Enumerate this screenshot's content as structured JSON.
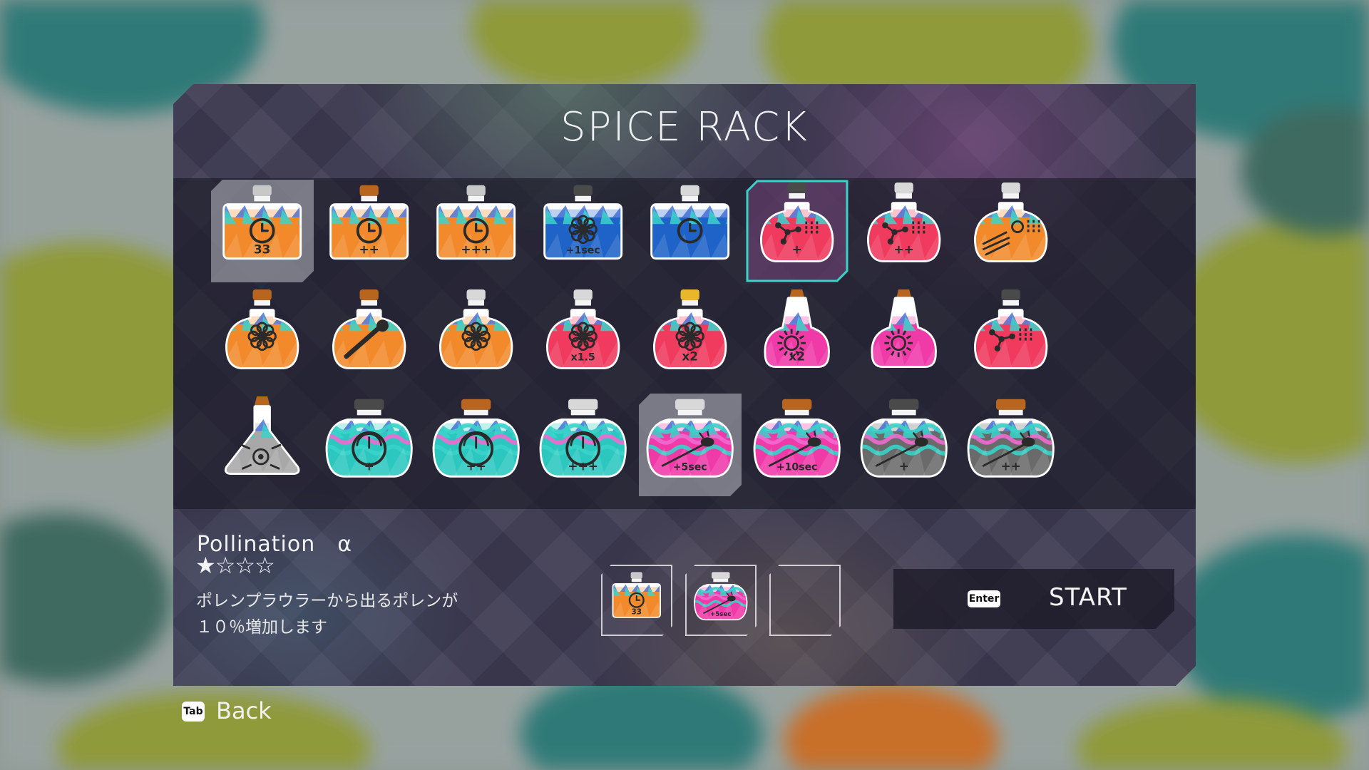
{
  "screen": {
    "title": "SPICE RACK"
  },
  "spices": [
    {
      "row": 0,
      "col": 0,
      "liquid": "#f28a2c",
      "cap": "#c8c8c8",
      "shape": "square",
      "icon": "clock-icon",
      "label": "33",
      "state": "hover"
    },
    {
      "row": 0,
      "col": 1,
      "liquid": "#f28a2c",
      "cap": "#b8661f",
      "shape": "square",
      "icon": "clock-icon",
      "label": "++",
      "state": "normal"
    },
    {
      "row": 0,
      "col": 2,
      "liquid": "#f28a2c",
      "cap": "#c8c8c8",
      "shape": "square",
      "icon": "clock-icon",
      "label": "+++",
      "state": "normal"
    },
    {
      "row": 0,
      "col": 3,
      "liquid": "#1f63c8",
      "cap": "#4a4a4a",
      "shape": "square",
      "icon": "flower-icon",
      "label": "+1sec",
      "state": "normal"
    },
    {
      "row": 0,
      "col": 4,
      "liquid": "#1f63c8",
      "cap": "#d8d8d8",
      "shape": "square",
      "icon": "clock-icon",
      "label": "",
      "state": "normal"
    },
    {
      "row": 0,
      "col": 5,
      "liquid": "#f03a5e",
      "cap": "#4a4a4a",
      "shape": "round",
      "icon": "molecule-icon",
      "label": "+",
      "state": "selected"
    },
    {
      "row": 0,
      "col": 6,
      "liquid": "#f03a5e",
      "cap": "#d8d8d8",
      "shape": "round",
      "icon": "molecule-icon",
      "label": "++",
      "state": "normal"
    },
    {
      "row": 0,
      "col": 7,
      "liquid": "#f28a2c",
      "cap": "#d8d8d8",
      "shape": "round",
      "icon": "burst-icon",
      "label": "",
      "state": "normal"
    },
    {
      "row": 1,
      "col": 0,
      "liquid": "#f28a2c",
      "cap": "#b8661f",
      "shape": "round",
      "icon": "flower-icon",
      "label": "",
      "state": "normal"
    },
    {
      "row": 1,
      "col": 1,
      "liquid": "#f28a2c",
      "cap": "#b8661f",
      "shape": "round",
      "icon": "syringe-icon",
      "label": "",
      "state": "normal"
    },
    {
      "row": 1,
      "col": 2,
      "liquid": "#f28a2c",
      "cap": "#d8d8d8",
      "shape": "round",
      "icon": "flower-icon",
      "label": "",
      "state": "normal"
    },
    {
      "row": 1,
      "col": 3,
      "liquid": "#f03a5e",
      "cap": "#d8d8d8",
      "shape": "round",
      "icon": "flower-icon",
      "label": "x1.5",
      "state": "normal"
    },
    {
      "row": 1,
      "col": 4,
      "liquid": "#f03a5e",
      "cap": "#e8b82a",
      "shape": "round",
      "icon": "flower-icon",
      "label": "x2",
      "state": "normal"
    },
    {
      "row": 1,
      "col": 5,
      "liquid": "#f03aa8",
      "cap": "#b8661f",
      "shape": "tall",
      "icon": "sun-icon",
      "label": "x2",
      "state": "normal"
    },
    {
      "row": 1,
      "col": 6,
      "liquid": "#f03aa8",
      "cap": "#b8661f",
      "shape": "tall",
      "icon": "sun-icon",
      "label": "",
      "state": "normal"
    },
    {
      "row": 1,
      "col": 7,
      "liquid": "#f03a5e",
      "cap": "#4a4a4a",
      "shape": "round",
      "icon": "molecule-icon",
      "label": "",
      "state": "normal"
    },
    {
      "row": 2,
      "col": 0,
      "liquid": "#a8a8a8",
      "cap": "#b8661f",
      "shape": "flask",
      "icon": "eye-icon",
      "label": "",
      "state": "normal"
    },
    {
      "row": 2,
      "col": 1,
      "liquid": "#2cc8c0",
      "cap": "#4a4a4a",
      "shape": "wide",
      "icon": "dial-icon",
      "label": "+",
      "state": "normal"
    },
    {
      "row": 2,
      "col": 2,
      "liquid": "#2cc8c0",
      "cap": "#b8661f",
      "shape": "wide",
      "icon": "dial-icon",
      "label": "++",
      "state": "normal"
    },
    {
      "row": 2,
      "col": 3,
      "liquid": "#2cc8c0",
      "cap": "#d8d8d8",
      "shape": "wide",
      "icon": "dial-icon",
      "label": "+++",
      "state": "normal"
    },
    {
      "row": 2,
      "col": 4,
      "liquid": "#f03aa8",
      "cap": "#d8d8d8",
      "shape": "wide",
      "icon": "bee-icon",
      "label": "+5sec",
      "state": "hover"
    },
    {
      "row": 2,
      "col": 5,
      "liquid": "#f03aa8",
      "cap": "#b8661f",
      "shape": "wide",
      "icon": "bee-icon",
      "label": "+10sec",
      "state": "normal"
    },
    {
      "row": 2,
      "col": 6,
      "liquid": "#6a6a6a",
      "cap": "#4a4a4a",
      "shape": "wide",
      "icon": "bee-icon",
      "label": "+",
      "state": "normal"
    },
    {
      "row": 2,
      "col": 7,
      "liquid": "#6a6a6a",
      "cap": "#b8661f",
      "shape": "wide",
      "icon": "bee-icon",
      "label": "++",
      "state": "normal"
    }
  ],
  "detail": {
    "name": "Pollination　α",
    "rating": "★☆☆☆",
    "description_line1": "ポレンプラウラーから出るポレンが",
    "description_line2": "１０％増加します"
  },
  "equipped": [
    {
      "liquid": "#f28a2c",
      "cap": "#c8c8c8",
      "shape": "square",
      "icon": "clock-icon",
      "label": "33"
    },
    {
      "liquid": "#f03aa8",
      "cap": "#d8d8d8",
      "shape": "wide",
      "icon": "bee-icon",
      "label": "+5sec"
    },
    null
  ],
  "start": {
    "key": "Enter",
    "label": "START"
  },
  "back": {
    "key": "Tab",
    "label": "Back"
  },
  "colors": {
    "accent": "#39d3c9",
    "panel": "#3d3a52"
  }
}
